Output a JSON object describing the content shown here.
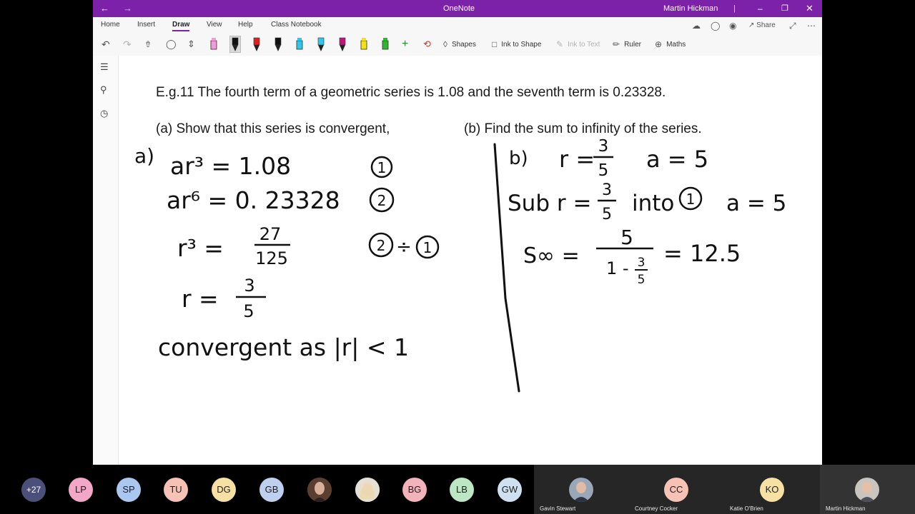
{
  "window": {
    "app_title": "OneNote",
    "user_name": "Martin Hickman",
    "back_icon": "back-arrow-icon",
    "forward_icon": "forward-arrow-icon"
  },
  "ribbon": {
    "tabs": [
      {
        "label": "Home",
        "active": false
      },
      {
        "label": "Insert",
        "active": false
      },
      {
        "label": "Draw",
        "active": true
      },
      {
        "label": "View",
        "active": false
      },
      {
        "label": "Help",
        "active": false
      },
      {
        "label": "Class Notebook",
        "active": false
      }
    ],
    "share_label": "Share",
    "tools": {
      "shapes": "Shapes",
      "ink_to_shape": "Ink to Shape",
      "ink_to_text": "Ink to Text",
      "ruler": "Ruler",
      "maths": "Maths"
    },
    "pen_colors": [
      "#f39ad9",
      "#111111",
      "#e02020",
      "#111111",
      "#2fc6e8",
      "#2fc6e8",
      "#c0157a",
      "#f5e11a",
      "#2fb52f"
    ]
  },
  "page": {
    "heading": "E.g.11  The fourth term of a geometric series is 1.08 and the seventh term is 0.23328.",
    "part_a": "(a) Show that this series is convergent,",
    "part_b": "(b) Find the sum to infinity of the series.",
    "ink_a": {
      "label": "a)",
      "eq1": "ar³ = 1.08",
      "eq1_tag": "1",
      "eq2": "ar⁶ = 0. 23328",
      "eq2_tag": "2",
      "eq3_lhs": "r³ =",
      "eq3_num": "27",
      "eq3_den": "125",
      "eq3_tag_a": "2",
      "eq3_op": "÷",
      "eq3_tag_b": "1",
      "eq4_lhs": "r =",
      "eq4_num": "3",
      "eq4_den": "5",
      "conclusion": "convergent as |r| < 1"
    },
    "ink_b": {
      "label": "b)",
      "r_lhs": "r =",
      "r_num": "3",
      "r_den": "5",
      "a_val": "a = 5",
      "sub_text": "Sub  r =",
      "sub_num": "3",
      "sub_den": "5",
      "sub_into": "into",
      "sub_tag": "1",
      "sub_result": "a = 5",
      "s_label": "S∞ =",
      "s_num": "5",
      "s_den_pre": "1 -",
      "s_den_num": "3",
      "s_den_den": "5",
      "s_result": "= 12.5"
    }
  },
  "participants": {
    "overflow_count": "+27",
    "avatars": [
      {
        "initials": "LP",
        "color": "#f2a7c9"
      },
      {
        "initials": "SP",
        "color": "#a9c7ef"
      },
      {
        "initials": "TU",
        "color": "#f6c2b6"
      },
      {
        "initials": "DG",
        "color": "#f7e0a3"
      },
      {
        "initials": "GB",
        "color": "#bfd0ef"
      },
      {
        "initials": "BG",
        "color": "#f2b3ba"
      },
      {
        "initials": "LB",
        "color": "#bde6c5"
      },
      {
        "initials": "GW",
        "color": "#cfe1f0"
      }
    ],
    "tiles": [
      {
        "name": "Gavin Stewart"
      },
      {
        "name": "Courtney Cocker",
        "initials": "CC",
        "color": "#f6c2b6"
      },
      {
        "name": "Katie O'Brien",
        "initials": "KO",
        "color": "#f7e0a3"
      },
      {
        "name": "Martin Hickman"
      }
    ]
  }
}
